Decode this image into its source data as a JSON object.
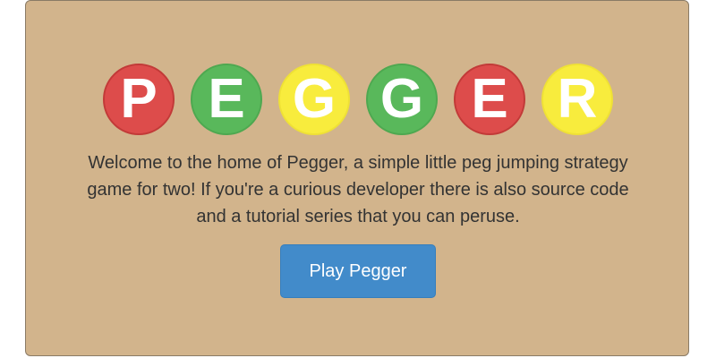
{
  "logo": {
    "letters": [
      {
        "char": "P",
        "color": "#dd4c4b"
      },
      {
        "char": "E",
        "color": "#59b85b"
      },
      {
        "char": "G",
        "color": "#f8ec3d"
      },
      {
        "char": "G",
        "color": "#59b85b"
      },
      {
        "char": "E",
        "color": "#dd4c4b"
      },
      {
        "char": "R",
        "color": "#f8ec3d"
      }
    ]
  },
  "intro": {
    "text": "Welcome to the home of Pegger, a simple little peg jumping strategy game for two! If you're a curious developer there is also source code and a tutorial series that you can peruse."
  },
  "actions": {
    "play_label": "Play Pegger"
  },
  "colors": {
    "panel_background": "#d2b48c",
    "button_primary": "#428bca"
  }
}
